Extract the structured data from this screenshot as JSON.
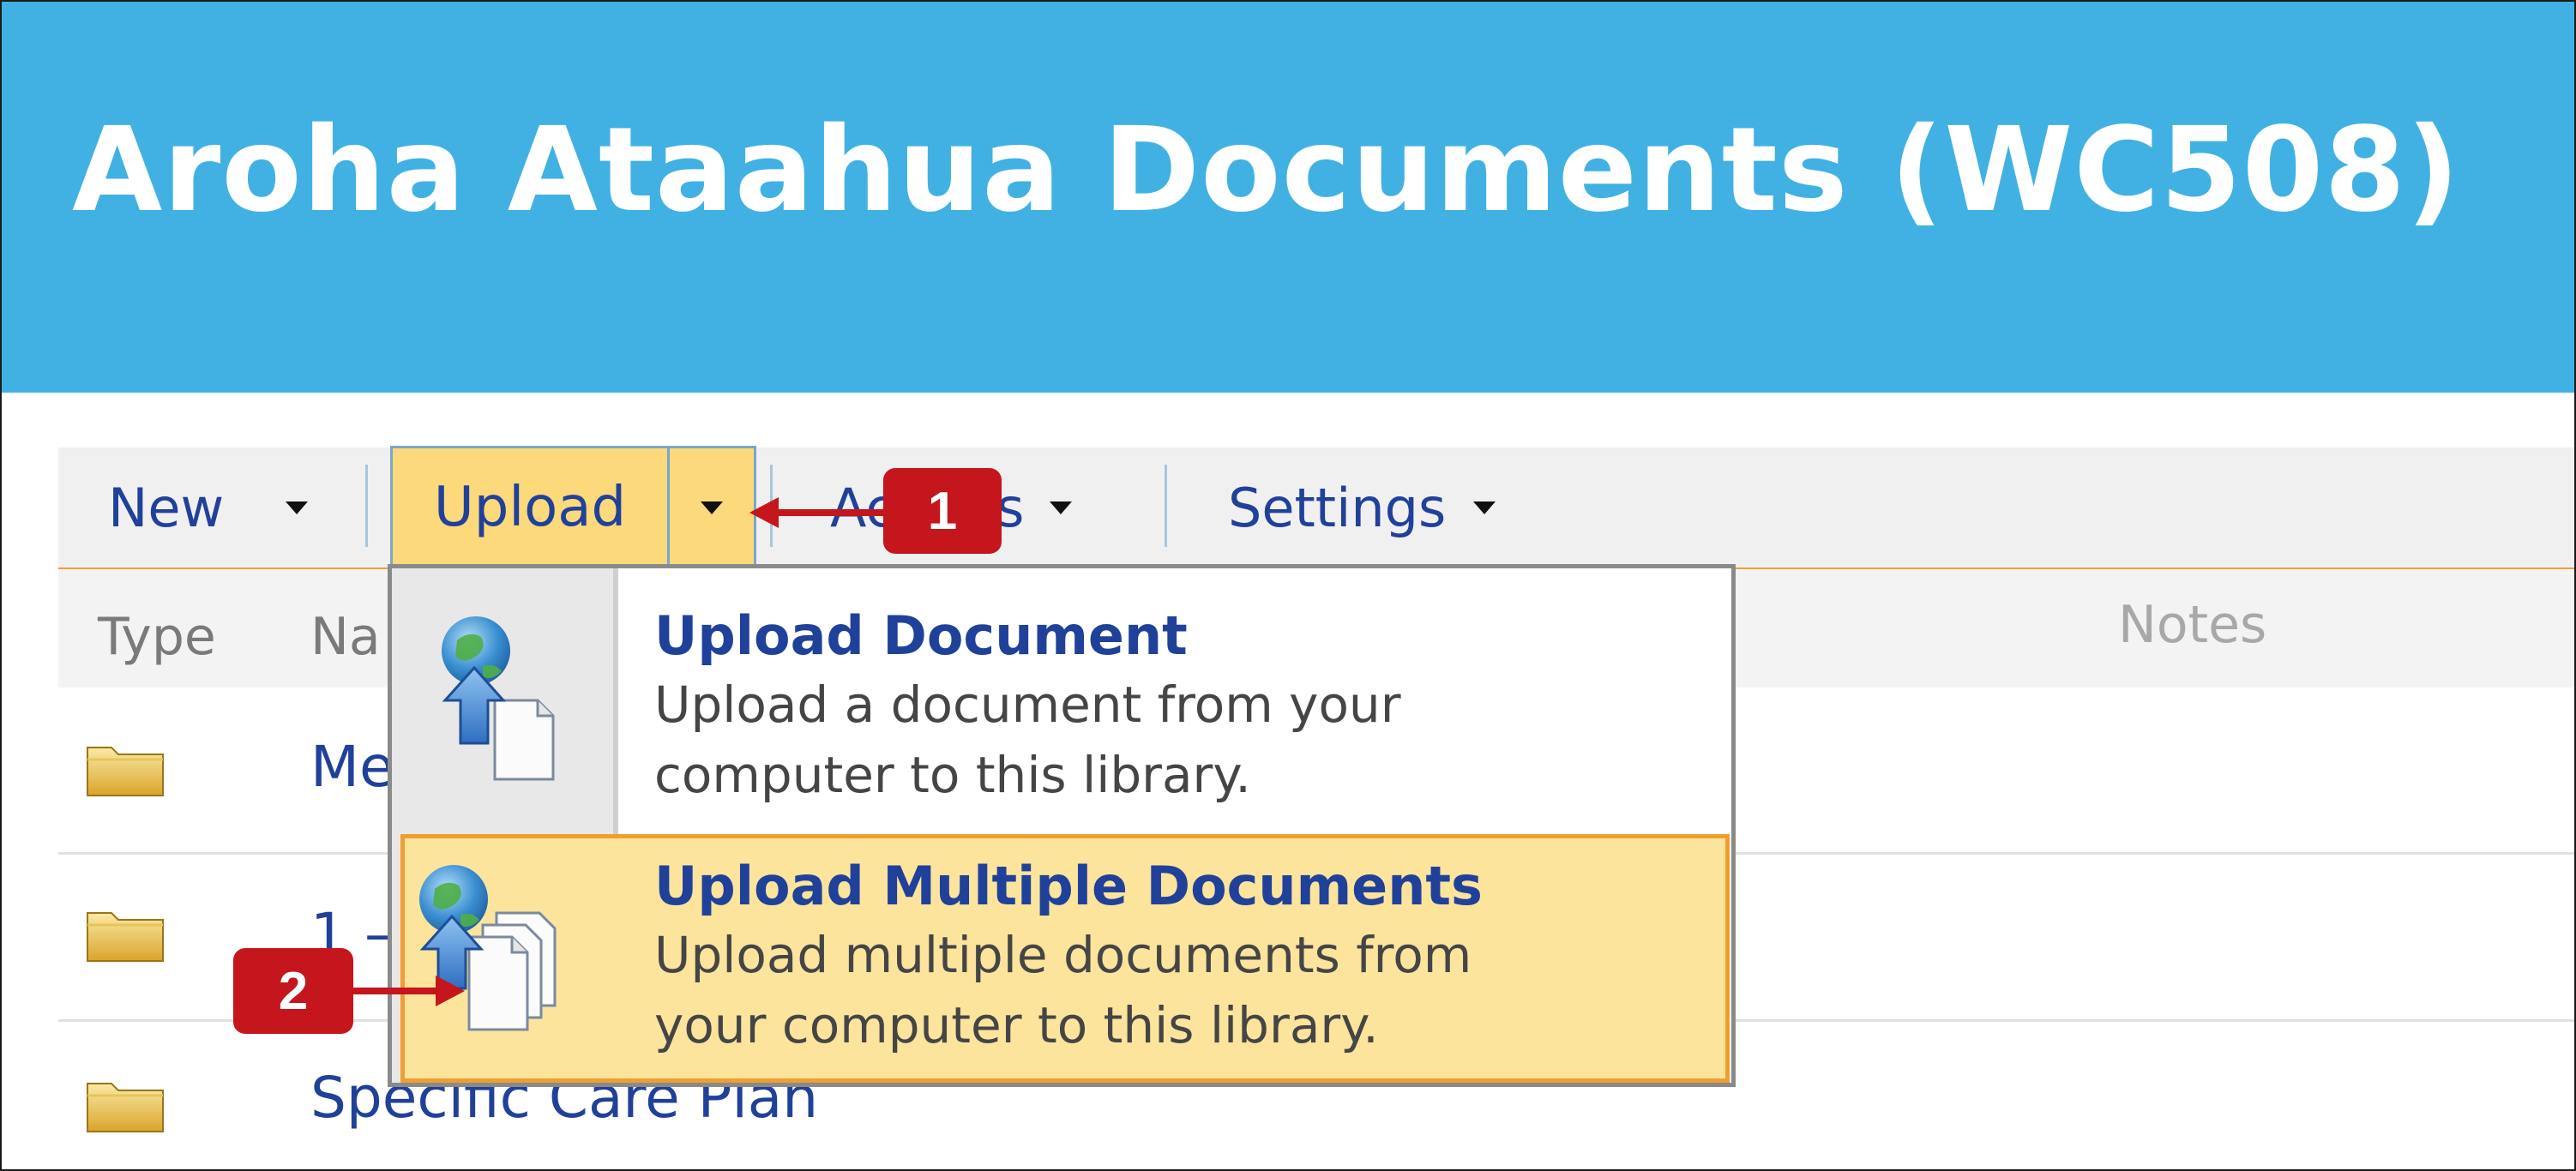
{
  "banner": {
    "title": "Aroha Ataahua Documents (WC508)",
    "color": "#41b1e4"
  },
  "toolbar": {
    "new_label": "New",
    "upload_label": "Upload",
    "actions_label": "Actions",
    "settings_label": "Settings"
  },
  "columns": {
    "type": "Type",
    "name": "Na",
    "notes": "Notes"
  },
  "rows": [
    {
      "name": "Me",
      "icon": "folder-icon"
    },
    {
      "name": "1 –",
      "icon": "folder-icon"
    },
    {
      "name": "Specific Care Plan",
      "icon": "folder-icon"
    }
  ],
  "upload_menu": {
    "items": [
      {
        "title": "Upload Document",
        "desc_line1": "Upload a document from your",
        "desc_line2": "computer to this library.",
        "icon": "upload-document-icon"
      },
      {
        "title": "Upload Multiple Documents",
        "desc_line1": "Upload multiple documents from",
        "desc_line2": "your computer to this library.",
        "icon": "upload-multiple-documents-icon",
        "highlighted": true
      }
    ]
  },
  "callouts": [
    {
      "label": "1"
    },
    {
      "label": "2"
    }
  ],
  "colors": {
    "accent": "#f19e31",
    "highlight": "#fde49c",
    "link": "#20419a",
    "callout": "#c4161c"
  }
}
